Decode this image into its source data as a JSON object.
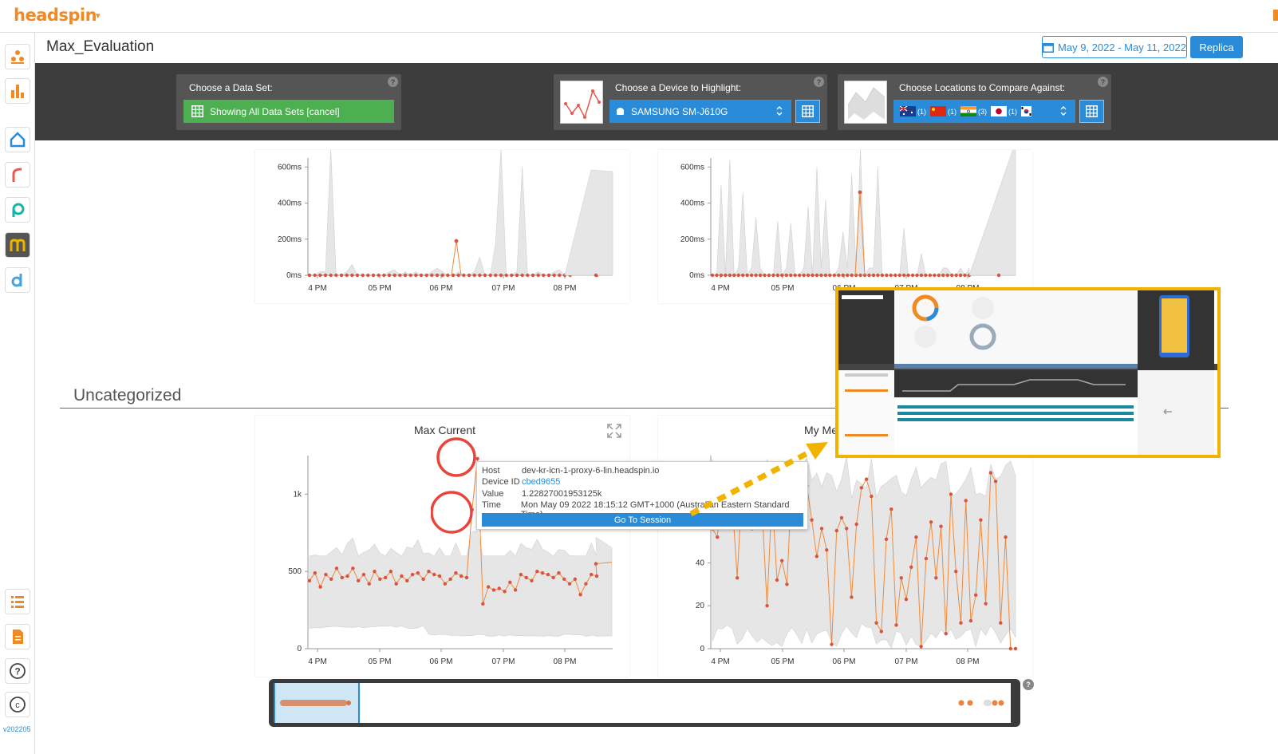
{
  "header": {
    "logo": "headspin",
    "logo_caret": "▾"
  },
  "version": "v202205",
  "page": {
    "title": "Max_Evaluation",
    "date_range": "May 9, 2022 - May 11, 2022",
    "replica_label": "Replica"
  },
  "sidebar": {
    "items": [
      {
        "name": "sidebar-item-teams",
        "icon": "people-icon"
      },
      {
        "name": "sidebar-item-analytics",
        "icon": "bar-chart-icon"
      },
      {
        "name": "sidebar-item-home",
        "icon": "home-icon"
      },
      {
        "name": "sidebar-item-r",
        "icon": "r-app-icon"
      },
      {
        "name": "sidebar-item-p",
        "icon": "p-app-icon"
      },
      {
        "name": "sidebar-item-m",
        "icon": "m-app-icon"
      },
      {
        "name": "sidebar-item-d",
        "icon": "d-app-icon"
      },
      {
        "name": "sidebar-item-list",
        "icon": "list-icon"
      },
      {
        "name": "sidebar-item-docs",
        "icon": "document-icon"
      },
      {
        "name": "sidebar-item-help",
        "icon": "help-icon"
      },
      {
        "name": "sidebar-item-copyright",
        "icon": "copyright-icon"
      }
    ]
  },
  "controls": {
    "dataset": {
      "label": "Choose a Data Set:",
      "button": "Showing All Data Sets [cancel]"
    },
    "device": {
      "label": "Choose a Device to Highlight:",
      "selected": "SAMSUNG SM-J610G"
    },
    "locations": {
      "label": "Choose Locations to Compare Against:",
      "flags": [
        {
          "country": "Australia",
          "count": "(1)"
        },
        {
          "country": "China",
          "count": "(1)"
        },
        {
          "country": "India",
          "count": "(3)"
        },
        {
          "country": "Japan",
          "count": "(1)"
        },
        {
          "country": "South Korea",
          "count": ""
        }
      ]
    },
    "help": "?"
  },
  "section": {
    "title": "Uncategorized"
  },
  "tooltip": {
    "host_label": "Host",
    "host": "dev-kr-icn-1-proxy-6-lin.headspin.io",
    "device_label": "Device ID",
    "device": "cbed9655",
    "value_label": "Value",
    "value": "1.22827001953125k",
    "time_label": "Time",
    "time": "Mon May 09 2022 18:15:12 GMT+1000 (Australian Eastern Standard Time)",
    "button": "Go To Session"
  },
  "chart_data": [
    {
      "type": "line",
      "title": "",
      "x_ticks": [
        "04 PM",
        "05 PM",
        "06 PM",
        "07 PM",
        "08 PM"
      ],
      "y_ticks": [
        "0ms",
        "200ms",
        "400ms",
        "600ms"
      ],
      "ylim": [
        0,
        650
      ],
      "series": [
        {
          "values": [
            0,
            0,
            0,
            0,
            0,
            0,
            0,
            0,
            0,
            0,
            0,
            0,
            0,
            0,
            0,
            0,
            0,
            0,
            0,
            0,
            0,
            0,
            0,
            0,
            0,
            0,
            0,
            0,
            0,
            0,
            0,
            0,
            0,
            0,
            0,
            0,
            0,
            0,
            0,
            0,
            0,
            0,
            0,
            0,
            0,
            0,
            0,
            0,
            0,
            0,
            0,
            0,
            0,
            0,
            0,
            0,
            0,
            0,
            0,
            0,
            0,
            0,
            0,
            0,
            0,
            0,
            0,
            0,
            0,
            0,
            0,
            0,
            0,
            0,
            0,
            0,
            0,
            0,
            0,
            0
          ]
        }
      ],
      "highlight": {
        "x": "06:15 PM",
        "value": 190
      }
    },
    {
      "type": "line",
      "title": "",
      "x_ticks": [
        "04 PM",
        "05 PM",
        "06 PM",
        "07 PM",
        "08 PM"
      ],
      "y_ticks": [
        "0ms",
        "200ms",
        "400ms",
        "600ms"
      ],
      "ylim": [
        0,
        650
      ],
      "highlight": {
        "x": "06:20 PM",
        "value": 460
      }
    },
    {
      "type": "line",
      "title": "Max Current",
      "x_ticks": [
        "04 PM",
        "05 PM",
        "06 PM",
        "07 PM",
        "08 PM"
      ],
      "y_ticks": [
        "0",
        "500",
        "1k"
      ],
      "ylim": [
        0,
        1300
      ],
      "series": [
        {
          "values": [
            440,
            490,
            400,
            480,
            450,
            520,
            460,
            470,
            520,
            440,
            480,
            420,
            500,
            450,
            460,
            500,
            420,
            470,
            440,
            480,
            490,
            450,
            500,
            480,
            470,
            420,
            450,
            490,
            470,
            460,
            900,
            1230,
            290,
            400,
            380,
            390,
            370,
            430,
            380,
            480,
            460,
            440,
            500,
            490,
            480,
            460,
            490,
            450,
            420,
            450,
            350,
            420,
            480,
            470,
            550,
            560
          ]
        }
      ]
    },
    {
      "type": "line",
      "title": "My Me",
      "x_ticks": [
        "04 PM",
        "05 PM",
        "06 PM",
        "07 PM",
        "08 PM"
      ],
      "y_ticks": [
        "0",
        "20",
        "40",
        "60"
      ]
    }
  ],
  "navigator": {
    "help": "?"
  }
}
